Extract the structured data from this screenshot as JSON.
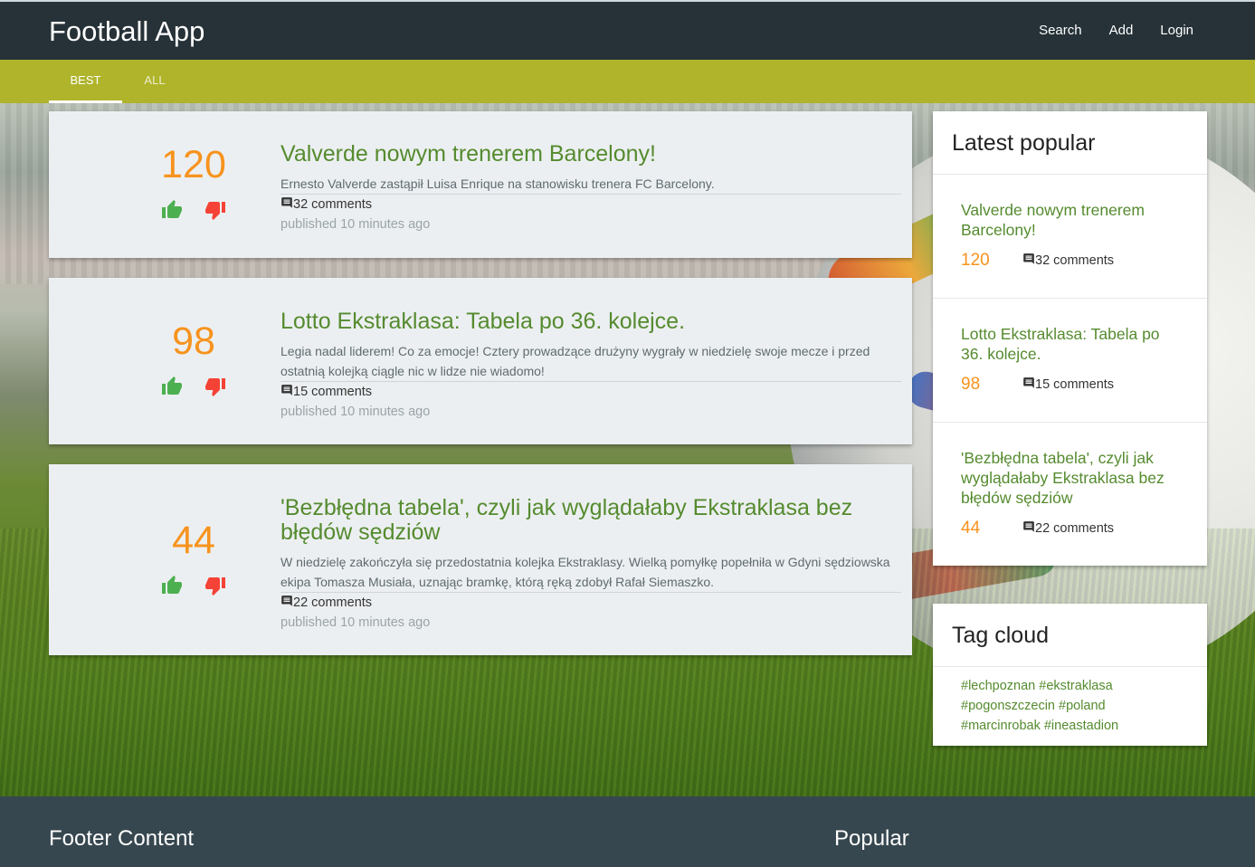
{
  "app": {
    "title": "Football App"
  },
  "topnav": {
    "search": "Search",
    "add": "Add",
    "login": "Login"
  },
  "tabs": [
    {
      "label": "BEST",
      "active": true
    },
    {
      "label": "ALL",
      "active": false
    }
  ],
  "articles": [
    {
      "score": "120",
      "title": "Valverde nowym trenerem Barcelony!",
      "excerpt": "Ernesto Valverde zastąpił Luisa Enrique na stanowisku trenera FC Barcelony.",
      "comments": "32 comments",
      "published": "published 10 minutes ago"
    },
    {
      "score": "98",
      "title": "Lotto Ekstraklasa: Tabela po 36. kolejce.",
      "excerpt": "Legia nadal liderem! Co za emocje! Cztery prowadzące drużyny wygrały w niedzielę swoje mecze i przed ostatnią kolejką ciągle nic w lidze nie wiadomo!",
      "comments": "15 comments",
      "published": "published 10 minutes ago"
    },
    {
      "score": "44",
      "title": "'Bezbłędna tabela', czyli jak wyglądałaby Ekstraklasa bez błędów sędziów",
      "excerpt": "W niedzielę zakończyła się przedostatnia kolejka Ekstraklasy. Wielką pomyłkę popełniła w Gdyni sędziowska ekipa Tomasza Musiała, uznając bramkę, którą ręką zdobył Rafał Siemaszko.",
      "comments": "22 comments",
      "published": "published 10 minutes ago"
    }
  ],
  "latest_popular": {
    "title": "Latest popular",
    "items": [
      {
        "title": "Valverde nowym trenerem Barcelony!",
        "score": "120",
        "comments": "32 comments"
      },
      {
        "title": "Lotto Ekstraklasa: Tabela po 36. kolejce.",
        "score": "98",
        "comments": "15 comments"
      },
      {
        "title": "'Bezbłędna tabela', czyli jak wyglądałaby Ekstraklasa bez błędów sędziów",
        "score": "44",
        "comments": "22 comments"
      }
    ]
  },
  "tag_cloud": {
    "title": "Tag cloud",
    "tags": "#lechpoznan #ekstraklasa #pogonszczecin #poland #marcinrobak #ineastadion"
  },
  "footer": {
    "content_title": "Footer Content",
    "popular_title": "Popular"
  },
  "colors": {
    "header": "#263238",
    "tabbar": "#afb42b",
    "score": "#f7931e",
    "link": "#558b2f",
    "up": "#4caf50",
    "down": "#f44336",
    "footer": "#37474f"
  },
  "icons": {
    "upvote": "thumb-up-icon",
    "downvote": "thumb-down-icon",
    "comments": "comment-icon"
  }
}
